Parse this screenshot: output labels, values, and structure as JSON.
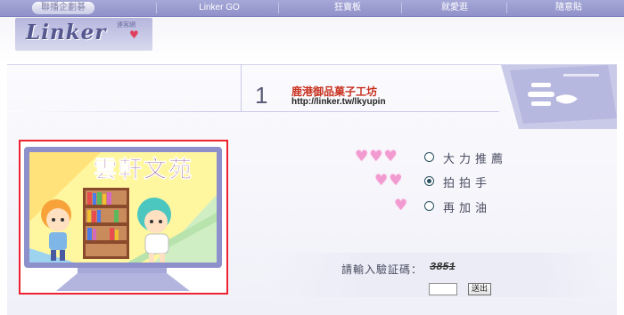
{
  "nav": {
    "items": [
      {
        "label": "聯播企劃碁"
      },
      {
        "label": "Linker GO"
      },
      {
        "label": "狂賣板"
      },
      {
        "label": "就愛逛"
      },
      {
        "label": "隨意貼"
      }
    ]
  },
  "logo": {
    "text": "Linker",
    "subtitle": "連客網"
  },
  "listing": {
    "rank": "1",
    "shop_name": "鹿港御品菓子工坊",
    "shop_url": "http://linker.tw/lkyupin"
  },
  "banner": {
    "title": "雲軒文苑"
  },
  "vote": {
    "options": [
      {
        "label": "大力推薦",
        "hearts": 3,
        "checked": false
      },
      {
        "label": "拍拍手",
        "hearts": 2,
        "checked": true
      },
      {
        "label": "再加油",
        "hearts": 1,
        "checked": false
      }
    ]
  },
  "captcha": {
    "prompt": "請輸入驗証碼：",
    "code": "3851",
    "input_value": "",
    "submit_label": "送出"
  },
  "colors": {
    "nav_bg": "#9a9cd0",
    "shop_name": "#c8301e",
    "banner_border": "#ee2230",
    "heart": "#f29bd0"
  }
}
